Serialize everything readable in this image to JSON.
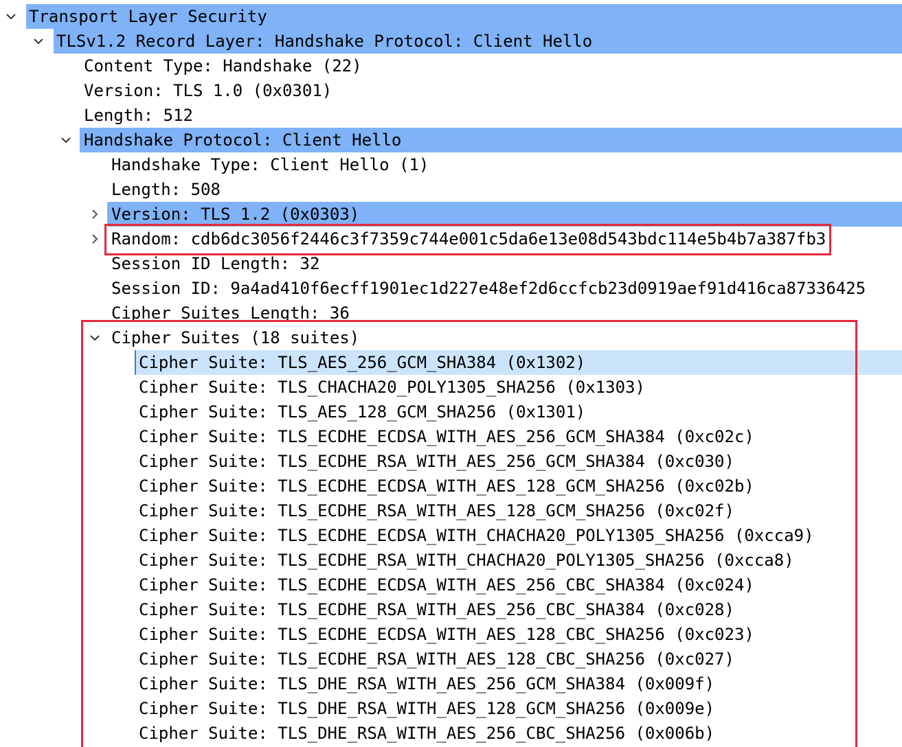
{
  "tree": {
    "tls": {
      "label": "Transport Layer Security"
    },
    "record": {
      "label": "TLSv1.2 Record Layer: Handshake Protocol: Client Hello"
    },
    "content_type": {
      "label": "Content Type: Handshake (22)"
    },
    "record_version": {
      "label": "Version: TLS 1.0 (0x0301)"
    },
    "record_length": {
      "label": "Length: 512"
    },
    "handshake": {
      "label": "Handshake Protocol: Client Hello"
    },
    "handshake_type": {
      "label": "Handshake Type: Client Hello (1)"
    },
    "handshake_length": {
      "label": "Length: 508"
    },
    "handshake_version": {
      "label": "Version: TLS 1.2 (0x0303)"
    },
    "random": {
      "label": "Random: cdb6dc3056f2446c3f7359c744e001c5da6e13e08d543bdc114e5b4b7a387fb3"
    },
    "session_id_length": {
      "label": "Session ID Length: 32"
    },
    "session_id": {
      "label": "Session ID: 9a4ad410f6ecff1901ec1d227e48ef2d6ccfcb23d0919aef91d416ca87336425"
    },
    "cipher_suites_length": {
      "label": "Cipher Suites Length: 36"
    },
    "cipher_suites": {
      "label": "Cipher Suites (18 suites)"
    },
    "suites": [
      "Cipher Suite: TLS_AES_256_GCM_SHA384 (0x1302)",
      "Cipher Suite: TLS_CHACHA20_POLY1305_SHA256 (0x1303)",
      "Cipher Suite: TLS_AES_128_GCM_SHA256 (0x1301)",
      "Cipher Suite: TLS_ECDHE_ECDSA_WITH_AES_256_GCM_SHA384 (0xc02c)",
      "Cipher Suite: TLS_ECDHE_RSA_WITH_AES_256_GCM_SHA384 (0xc030)",
      "Cipher Suite: TLS_ECDHE_ECDSA_WITH_AES_128_GCM_SHA256 (0xc02b)",
      "Cipher Suite: TLS_ECDHE_RSA_WITH_AES_128_GCM_SHA256 (0xc02f)",
      "Cipher Suite: TLS_ECDHE_ECDSA_WITH_CHACHA20_POLY1305_SHA256 (0xcca9)",
      "Cipher Suite: TLS_ECDHE_RSA_WITH_CHACHA20_POLY1305_SHA256 (0xcca8)",
      "Cipher Suite: TLS_ECDHE_ECDSA_WITH_AES_256_CBC_SHA384 (0xc024)",
      "Cipher Suite: TLS_ECDHE_RSA_WITH_AES_256_CBC_SHA384 (0xc028)",
      "Cipher Suite: TLS_ECDHE_ECDSA_WITH_AES_128_CBC_SHA256 (0xc023)",
      "Cipher Suite: TLS_ECDHE_RSA_WITH_AES_128_CBC_SHA256 (0xc027)",
      "Cipher Suite: TLS_DHE_RSA_WITH_AES_256_GCM_SHA384 (0x009f)",
      "Cipher Suite: TLS_DHE_RSA_WITH_AES_128_GCM_SHA256 (0x009e)",
      "Cipher Suite: TLS_DHE_RSA_WITH_AES_256_CBC_SHA256 (0x006b)"
    ]
  },
  "icons": {
    "expanded": "chevron-down-icon",
    "collapsed": "chevron-right-icon"
  },
  "colors": {
    "header_highlight": "#7fb2f6",
    "selected_highlight": "#cce4fb",
    "annotation_box": "#e8283a"
  }
}
